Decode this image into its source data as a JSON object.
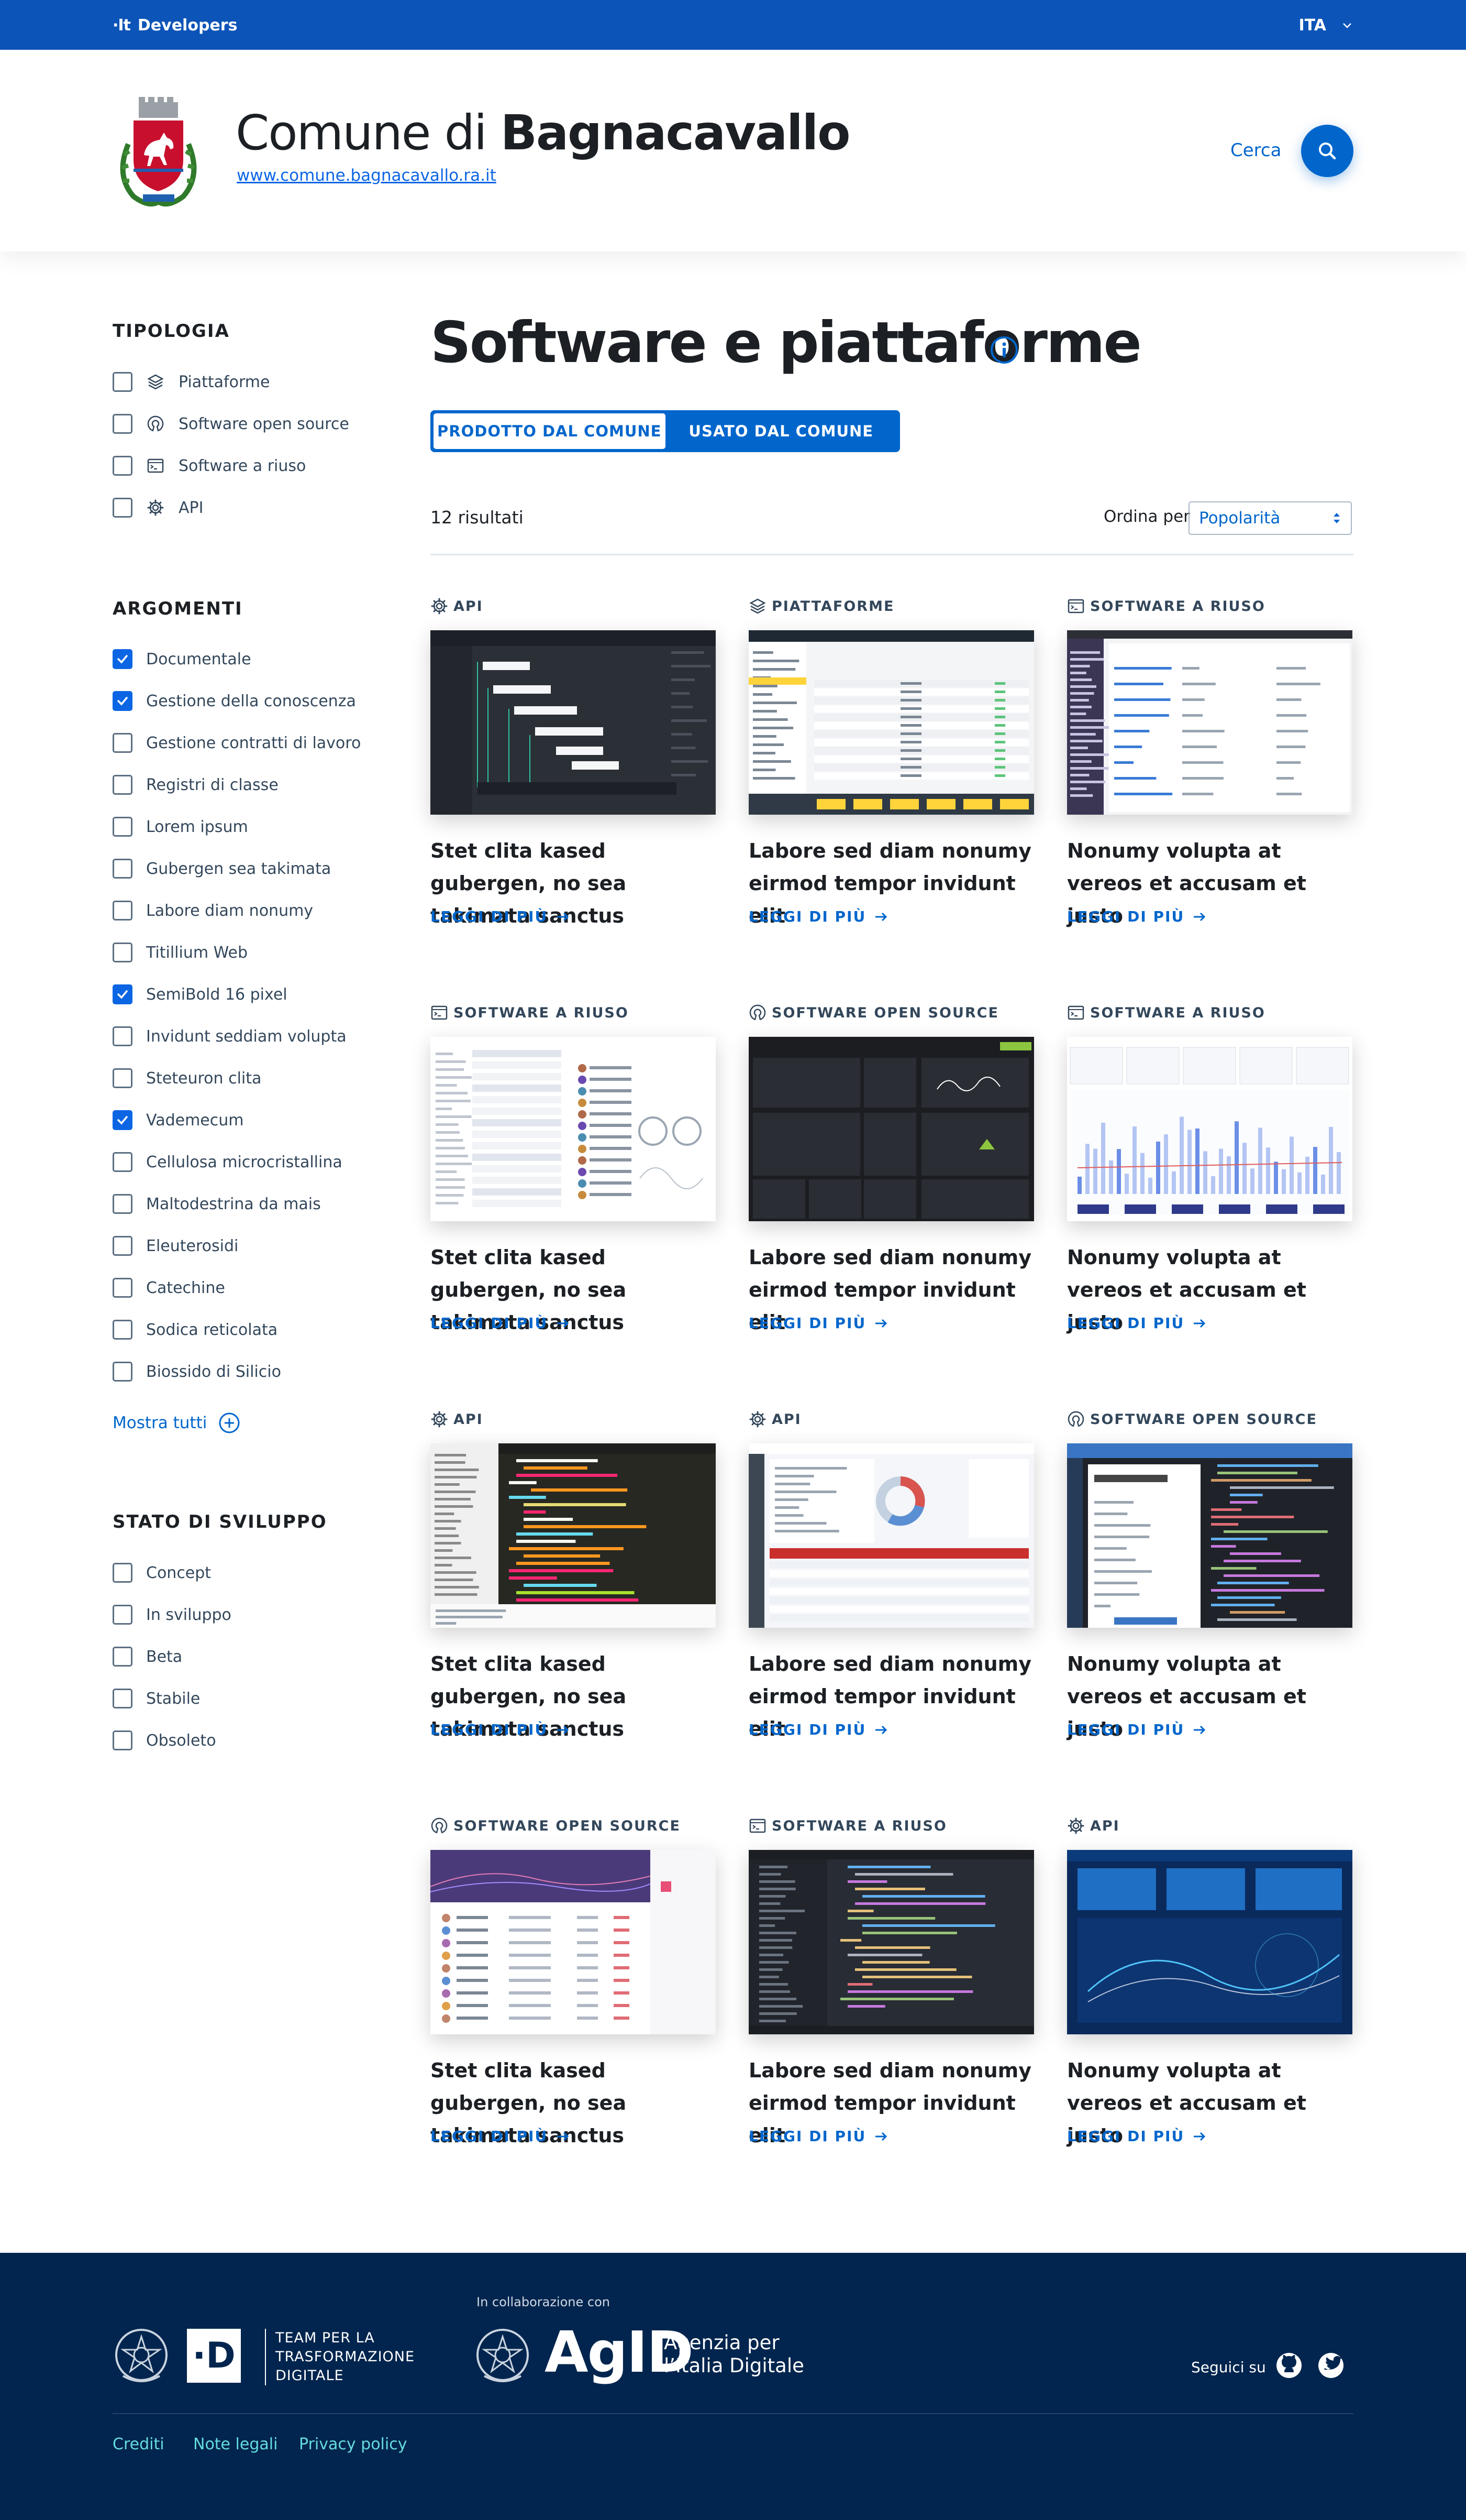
{
  "topbar": {
    "brand_logo": "·It",
    "brand_label": "Developers",
    "language": "ITA"
  },
  "header": {
    "title_prefix": "Comune di",
    "title_name": "Bagnacavallo",
    "url": "www.comune.bagnacavallo.ra.it",
    "search_label": "Cerca"
  },
  "sidebar": {
    "tipologia": {
      "title": "TIPOLOGIA",
      "items": [
        {
          "label": "Piattaforme",
          "icon": "layers-icon",
          "checked": false
        },
        {
          "label": "Software open source",
          "icon": "open-source-icon",
          "checked": false
        },
        {
          "label": "Software a riuso",
          "icon": "terminal-icon",
          "checked": false
        },
        {
          "label": "API",
          "icon": "gear-icon",
          "checked": false
        }
      ]
    },
    "argomenti": {
      "title": "ARGOMENTI",
      "items": [
        {
          "label": "Documentale",
          "checked": true
        },
        {
          "label": "Gestione della conoscenza",
          "checked": true
        },
        {
          "label": "Gestione contratti di lavoro",
          "checked": false
        },
        {
          "label": "Registri di classe",
          "checked": false
        },
        {
          "label": "Lorem ipsum",
          "checked": false
        },
        {
          "label": "Gubergen sea takimata",
          "checked": false
        },
        {
          "label": "Labore diam nonumy",
          "checked": false
        },
        {
          "label": "Titillium Web",
          "checked": false
        },
        {
          "label": "SemiBold 16 pixel",
          "checked": true
        },
        {
          "label": "Invidunt seddiam volupta",
          "checked": false
        },
        {
          "label": "Steteuron clita",
          "checked": false
        },
        {
          "label": "Vademecum",
          "checked": true
        },
        {
          "label": "Cellulosa microcristallina",
          "checked": false
        },
        {
          "label": "Maltodestrina da mais",
          "checked": false
        },
        {
          "label": "Eleuterosidi",
          "checked": false
        },
        {
          "label": "Catechine",
          "checked": false
        },
        {
          "label": "Sodica reticolata",
          "checked": false
        },
        {
          "label": "Biossido di Silicio",
          "checked": false
        }
      ]
    },
    "show_all": "Mostra tutti",
    "stato": {
      "title": "STATO DI SVILUPPO",
      "items": [
        {
          "label": "Concept",
          "checked": false
        },
        {
          "label": "In sviluppo",
          "checked": false
        },
        {
          "label": "Beta",
          "checked": false
        },
        {
          "label": "Stabile",
          "checked": false
        },
        {
          "label": "Obsoleto",
          "checked": false
        }
      ]
    }
  },
  "main": {
    "title": "Software e piattaforme",
    "tabs": [
      {
        "label": "PRODOTTO DAL COMUNE",
        "active": true
      },
      {
        "label": "USATO DAL COMUNE",
        "active": false
      }
    ],
    "results": "12 risultati",
    "sort_label": "Ordina per",
    "sort_value": "Popolarità",
    "read_more": "LEGGI DI PIÙ",
    "cards": [
      {
        "category": "API",
        "icon": "gear-icon",
        "title": "Stet clita kased gubergen, no sea takimata sanctus",
        "theme": "dark-tree"
      },
      {
        "category": "PIATTAFORME",
        "icon": "layers-icon",
        "title": "Labore sed diam nonumy eirmod tempor invidunt elit",
        "theme": "inventory"
      },
      {
        "category": "SOFTWARE A RIUSO",
        "icon": "terminal-icon",
        "title": "Nonumy volupta at vereos et accusam et justo",
        "theme": "admin-list"
      },
      {
        "category": "SOFTWARE A RIUSO",
        "icon": "terminal-icon",
        "title": "Stet clita kased gubergen, no sea takimata sanctus",
        "theme": "chat-ui"
      },
      {
        "category": "SOFTWARE OPEN SOURCE",
        "icon": "open-source-icon",
        "title": "Labore sed diam nonumy eirmod tempor invidunt elit",
        "theme": "dark-dashboard"
      },
      {
        "category": "SOFTWARE A RIUSO",
        "icon": "terminal-icon",
        "title": "Nonumy volupta at vereos et accusam et justo",
        "theme": "kpi-chart"
      },
      {
        "category": "API",
        "icon": "gear-icon",
        "title": "Stet clita kased gubergen, no sea takimata sanctus",
        "theme": "code-editor"
      },
      {
        "category": "API",
        "icon": "gear-icon",
        "title": "Labore sed diam nonumy eirmod tempor invidunt elit",
        "theme": "donut-dashboard"
      },
      {
        "category": "SOFTWARE OPEN SOURCE",
        "icon": "open-source-icon",
        "title": "Nonumy volupta at vereos et accusam et justo",
        "theme": "clean-zone"
      },
      {
        "category": "SOFTWARE OPEN SOURCE",
        "icon": "open-source-icon",
        "title": "Stet clita kased gubergen, no sea takimata sanctus",
        "theme": "purple-table"
      },
      {
        "category": "SOFTWARE A RIUSO",
        "icon": "terminal-icon",
        "title": "Labore sed diam nonumy eirmod tempor invidunt elit",
        "theme": "atom-editor"
      },
      {
        "category": "API",
        "icon": "gear-icon",
        "title": "Nonumy volupta at vereos et accusam et justo",
        "theme": "blue-map"
      }
    ]
  },
  "footer": {
    "team_text": "TEAM PER LA TRASFORMAZIONE DIGITALE",
    "collab_label": "In collaborazione con",
    "agid_mark": "AgID",
    "agid_text_line1": "Agenzia per",
    "agid_text_line2": "l’Italia Digitale",
    "follow_label": "Seguici su",
    "links": [
      "Crediti",
      "Note legali",
      "Privacy policy"
    ]
  },
  "colors": {
    "primary": "#0066cc",
    "topbar": "#0c54b8",
    "footer": "#01254e",
    "footer_links": "#65dcdf"
  }
}
